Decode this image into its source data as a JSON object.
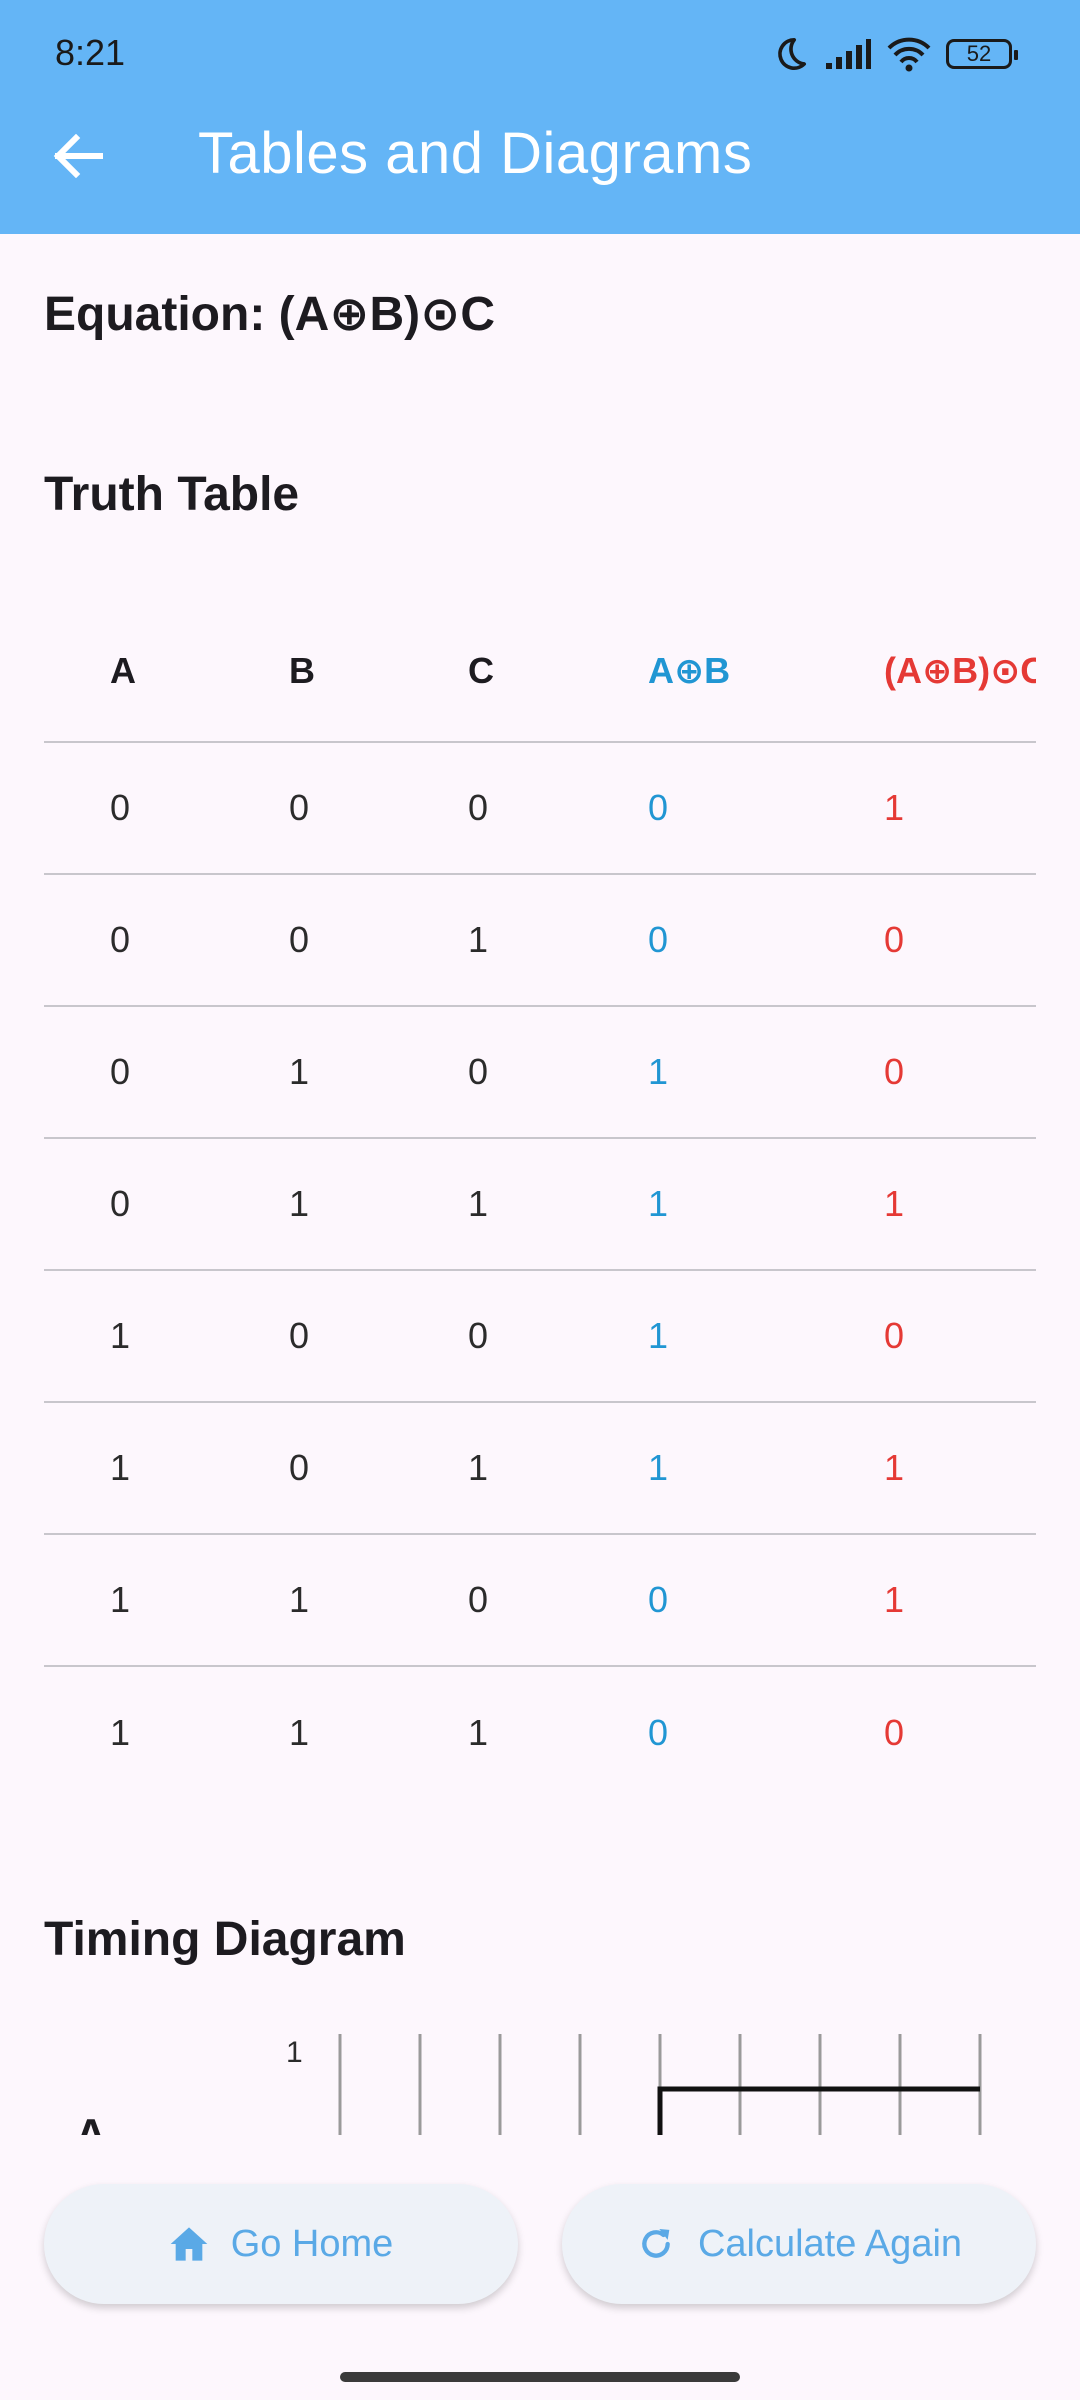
{
  "status_bar": {
    "time": "8:21",
    "battery": "52"
  },
  "app_bar": {
    "title": "Tables and Diagrams",
    "back_icon": "arrow-left-icon"
  },
  "equation": "Equation: (A⊕B)⊙C",
  "truth_table": {
    "title": "Truth Table",
    "headers": [
      "A",
      "B",
      "C",
      "A⊕B",
      "(A⊕B)⊙C"
    ],
    "rows": [
      [
        "0",
        "0",
        "0",
        "0",
        "1"
      ],
      [
        "0",
        "0",
        "1",
        "0",
        "0"
      ],
      [
        "0",
        "1",
        "0",
        "1",
        "0"
      ],
      [
        "0",
        "1",
        "1",
        "1",
        "1"
      ],
      [
        "1",
        "0",
        "0",
        "1",
        "0"
      ],
      [
        "1",
        "0",
        "1",
        "1",
        "1"
      ],
      [
        "1",
        "1",
        "0",
        "0",
        "1"
      ],
      [
        "1",
        "1",
        "1",
        "0",
        "0"
      ]
    ],
    "colors": {
      "intermediate": "#2196d3",
      "output": "#e53935"
    }
  },
  "timing_diagram": {
    "title": "Timing Diagram",
    "signal_label": "A",
    "level_label": "1",
    "signal_values": [
      0,
      0,
      0,
      0,
      1,
      1,
      1,
      1
    ]
  },
  "buttons": {
    "home": {
      "label": "Go Home",
      "icon": "home-icon"
    },
    "again": {
      "label": "Calculate Again",
      "icon": "refresh-icon"
    }
  },
  "colors": {
    "app_bar": "#64b5f6",
    "background": "#fdf7fd",
    "button_text": "#5aa9e6"
  }
}
